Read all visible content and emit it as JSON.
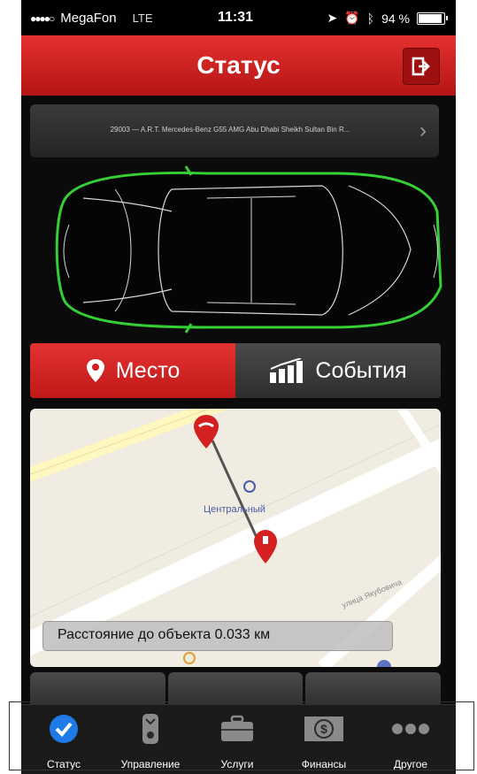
{
  "status_bar": {
    "carrier": "MegaFon",
    "network": "LTE",
    "time": "11:31",
    "battery": "94 %"
  },
  "header": {
    "title": "Статус"
  },
  "vehicle": {
    "label": "29003 — A.R.T. Mercedes-Benz G55 AMG Abu Dhabi Sheikh Sultan Bin R..."
  },
  "segments": [
    {
      "label": "Место",
      "active": true,
      "icon": "location-pin-icon"
    },
    {
      "label": "События",
      "active": false,
      "icon": "bar-chart-icon"
    }
  ],
  "map": {
    "place_label": "Центральный",
    "street_label": "улица Якубовича",
    "distance_text": "Расстояние до объекта 0.033 км"
  },
  "tabs": [
    {
      "label": "Статус",
      "icon": "checkmark-circle-icon",
      "active": true
    },
    {
      "label": "Управление",
      "icon": "remote-key-icon",
      "active": false
    },
    {
      "label": "Услуги",
      "icon": "briefcase-icon",
      "active": false
    },
    {
      "label": "Финансы",
      "icon": "dollar-bill-icon",
      "active": false
    },
    {
      "label": "Другое",
      "icon": "more-dots-icon",
      "active": false
    }
  ],
  "colors": {
    "accent_red": "#d42020",
    "active_tab_blue": "#1e7ae6",
    "car_outline_green": "#3ddc3d"
  }
}
